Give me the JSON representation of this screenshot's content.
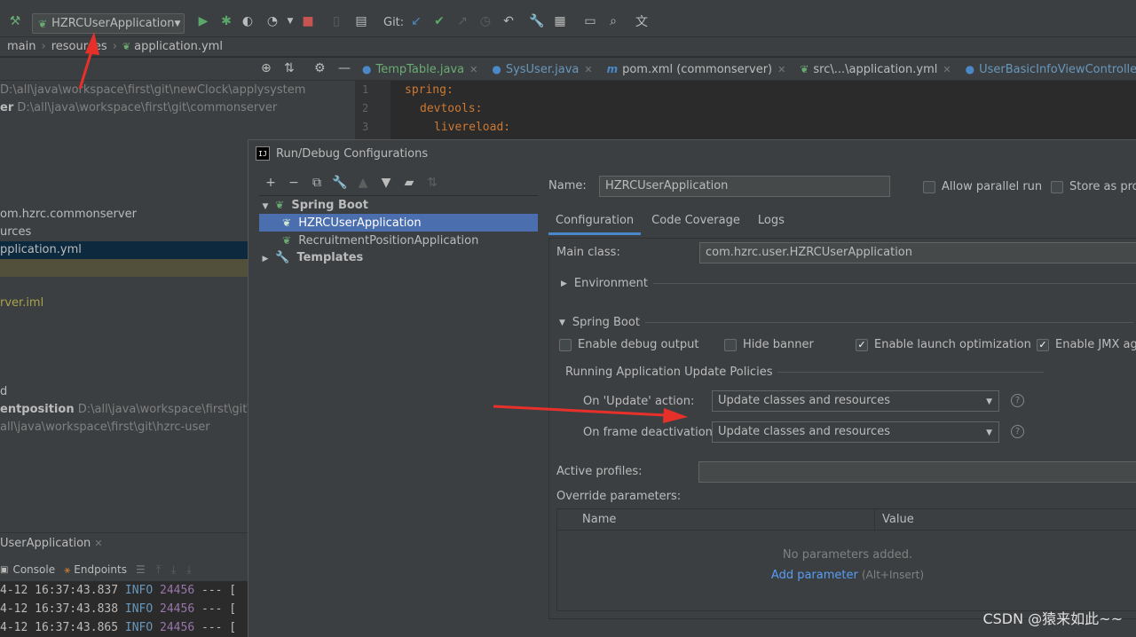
{
  "toolbar": {
    "run_config": "HZRCUserApplication",
    "git_label": "Git:"
  },
  "breadcrumbs": [
    "main",
    "resources",
    "application.yml"
  ],
  "project": {
    "rows": [
      {
        "name": "",
        "path": "D:\\all\\java\\workspace\\first\\git\\newClock\\applysystem"
      },
      {
        "name": "er",
        "path": "D:\\all\\java\\workspace\\first\\git\\commonserver"
      },
      {
        "name": "om.hzrc.commonserver",
        "path": ""
      },
      {
        "name": "urces",
        "path": ""
      },
      {
        "name": "pplication.yml",
        "path": ""
      },
      {
        "name": "rver.iml",
        "path": ""
      },
      {
        "name": "d",
        "path": ""
      },
      {
        "name": "entposition",
        "path": "D:\\all\\java\\workspace\\first\\git\\new"
      },
      {
        "name": "",
        "path": "all\\java\\workspace\\first\\git\\hzrc-user"
      }
    ]
  },
  "editor": {
    "tabs": [
      "TempTable.java",
      "SysUser.java",
      "pom.xml (commonserver)",
      "src\\...\\application.yml",
      "UserBasicInfoViewController.java"
    ],
    "line_numbers": [
      "1",
      "2",
      "3"
    ],
    "code": [
      "spring:",
      "devtools:",
      "livereload:"
    ]
  },
  "bottom": {
    "run_title": "UserApplication",
    "tabs": [
      "Console",
      "Endpoints"
    ],
    "log": [
      {
        "ts": "4-12 16:37:43.837",
        "level": "INFO",
        "pid": "24456",
        "rest": "--- ["
      },
      {
        "ts": "4-12 16:37:43.838",
        "level": "INFO",
        "pid": "24456",
        "rest": "--- ["
      },
      {
        "ts": "4-12 16:37:43.865",
        "level": "INFO",
        "pid": "24456",
        "rest": "--- ["
      }
    ]
  },
  "dialog": {
    "title": "Run/Debug Configurations",
    "app_icon": "IJ",
    "tree": {
      "spring_boot": "Spring Boot",
      "selected_item": "HZRCUserApplication",
      "other_item": "RecruitmentPositionApplication",
      "templates": "Templates"
    },
    "name_label": "Name:",
    "name_value": "HZRCUserApplication",
    "allow_parallel": "Allow parallel run",
    "store_as_project": "Store as proj",
    "tabs": [
      "Configuration",
      "Code Coverage",
      "Logs"
    ],
    "main_class_label": "Main class:",
    "main_class_value": "com.hzrc.user.HZRCUserApplication",
    "environment": "Environment",
    "spring_boot_section": "Spring Boot",
    "enable_debug": "Enable debug output",
    "hide_banner": "Hide banner",
    "enable_launch_opt": "Enable launch optimization",
    "enable_jmx": "Enable JMX age",
    "update_policies": "Running Application Update Policies",
    "on_update_label": "On 'Update' action:",
    "on_update_value": "Update classes and resources",
    "on_frame_label": "On frame deactivation:",
    "on_frame_value": "Update classes and resources",
    "active_profiles": "Active profiles:",
    "override_params": "Override parameters:",
    "table_headers": [
      "Name",
      "Value"
    ],
    "no_params": "No parameters added.",
    "add_param": "Add parameter",
    "add_param_hint": "(Alt+Insert)"
  },
  "watermark": "CSDN @猿来如此~~",
  "colors": {
    "accent": "#4b6eaf",
    "link": "#589df6",
    "arrow": "#e8302a"
  }
}
